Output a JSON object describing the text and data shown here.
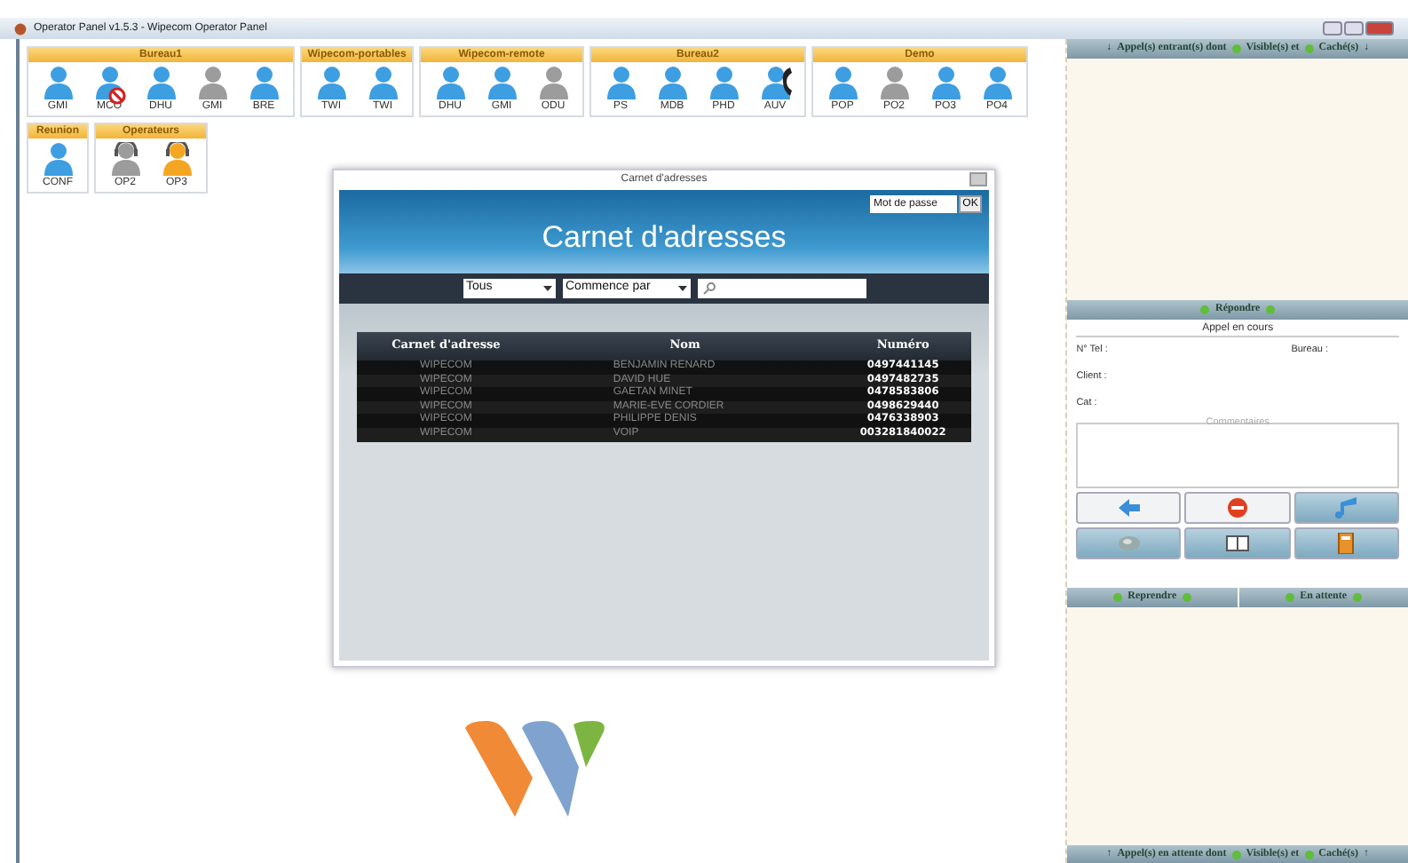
{
  "window": {
    "title": "Operator Panel v1.5.3 - Wipecom Operator Panel"
  },
  "groups": [
    {
      "name": "Bureau1",
      "users": [
        {
          "label": "GMI",
          "kind": "available"
        },
        {
          "label": "MCO",
          "kind": "dnd"
        },
        {
          "label": "DHU",
          "kind": "available"
        },
        {
          "label": "GMI",
          "kind": "offline"
        },
        {
          "label": "BRE",
          "kind": "available"
        }
      ]
    },
    {
      "name": "Wipecom-portables",
      "users": [
        {
          "label": "TWI",
          "kind": "available"
        },
        {
          "label": "TWI",
          "kind": "available"
        }
      ]
    },
    {
      "name": "Wipecom-remote",
      "users": [
        {
          "label": "DHU",
          "kind": "available"
        },
        {
          "label": "GMI",
          "kind": "available"
        },
        {
          "label": "ODU",
          "kind": "offline"
        }
      ]
    },
    {
      "name": "Bureau2",
      "users": [
        {
          "label": "PS",
          "kind": "available"
        },
        {
          "label": "MDB",
          "kind": "available"
        },
        {
          "label": "PHD",
          "kind": "available"
        },
        {
          "label": "AUV",
          "kind": "oncall"
        }
      ]
    },
    {
      "name": "Demo",
      "users": [
        {
          "label": "POP",
          "kind": "available"
        },
        {
          "label": "PO2",
          "kind": "offline"
        },
        {
          "label": "PO3",
          "kind": "available"
        },
        {
          "label": "PO4",
          "kind": "available"
        }
      ]
    },
    {
      "name": "Reunion",
      "users": [
        {
          "label": "CONF",
          "kind": "available"
        }
      ]
    },
    {
      "name": "Operateurs",
      "users": [
        {
          "label": "OP2",
          "kind": "operatoroffline"
        },
        {
          "label": "OP3",
          "kind": "operatoraway"
        }
      ]
    }
  ],
  "dialog": {
    "title": "Carnet d'adresses",
    "heading": "Carnet d'adresses",
    "password": {
      "placeholder": "Mot de passe"
    },
    "ok_button": "OK",
    "book_filter": "Tous",
    "mode_filter": "Commence par",
    "table": {
      "columns": [
        "Carnet d'adresse",
        "Nom",
        "Numéro"
      ],
      "rows": [
        [
          "WIPECOM",
          "BENJAMIN RENARD",
          "0497441145"
        ],
        [
          "WIPECOM",
          "DAVID HUE",
          "0497482735"
        ],
        [
          "WIPECOM",
          "GAETAN MINET",
          "0478583806"
        ],
        [
          "WIPECOM",
          "MARIE-EVE CORDIER",
          "0498629440"
        ],
        [
          "WIPECOM",
          "PHILIPPE DENIS",
          "0476338903"
        ],
        [
          "WIPECOM",
          "VOIP",
          "003281840022"
        ]
      ]
    }
  },
  "incoming_bar": {
    "arrow_left": "↓",
    "text": "Appel(s) entrant(s) dont",
    "visible": "Visible(s) et",
    "hidden": "Caché(s)",
    "arrow_right": "↓"
  },
  "answer_button": "Répondre",
  "call": {
    "legend": "Appel en cours",
    "fields": [
      {
        "label": "N° Tel :"
      },
      {
        "label": "Bureau :"
      },
      {
        "label": "Client :"
      },
      {
        "label": "Cat :"
      }
    ],
    "comments_legend": "Commentaires"
  },
  "actions": [
    {
      "kind": "back",
      "disabled": true
    },
    {
      "kind": "stop",
      "disabled": true
    },
    {
      "kind": "music",
      "disabled": false
    },
    {
      "kind": "disk",
      "disabled": false
    },
    {
      "kind": "book",
      "disabled": false
    },
    {
      "kind": "notepad",
      "disabled": false
    }
  ],
  "resume_button": "Reprendre",
  "hold_button": "En attente",
  "waiting_bar": {
    "arrow_left": "↑",
    "text": "Appel(s) en attente dont",
    "visible": "Visible(s) et",
    "hidden": "Caché(s)",
    "arrow_right": "↑"
  }
}
